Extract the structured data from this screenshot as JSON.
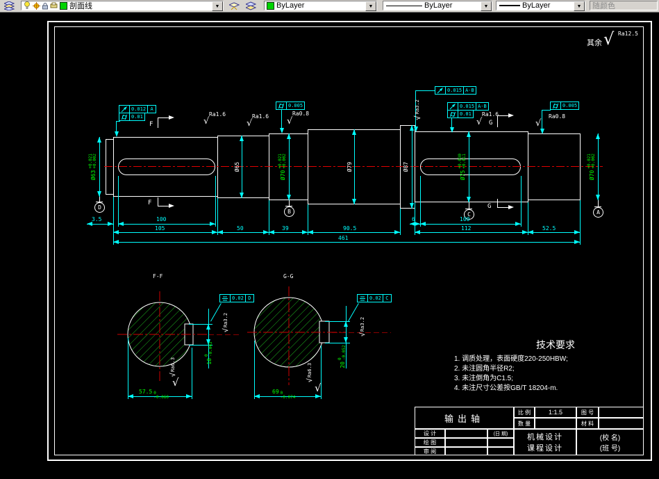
{
  "toolbar": {
    "layer_name": "剖面线",
    "color": "ByLayer",
    "linetype": "ByLayer",
    "lineweight": "ByLayer",
    "plot_style": "随颜色"
  },
  "sheet": {
    "rest_label": "其余",
    "rest_ra": "Ra12.5",
    "ra": {
      "a16": "Ra1.6",
      "a08": "Ra0.8",
      "a32": "Ra3.2",
      "a63": "Ra6.3"
    },
    "markers": {
      "f": "F",
      "g": "G"
    },
    "datums": {
      "left": "D",
      "mid": "B",
      "hub": "C",
      "right": "A"
    },
    "fcf": {
      "left": {
        "v1": "0.012",
        "d1": "A",
        "v2": "0.01"
      },
      "mid": {
        "v": "0.005"
      },
      "r1": {
        "v": "0.015",
        "d": "A-B"
      },
      "r2": {
        "v1": "0.015",
        "d1": "A-B",
        "v2": "0.01"
      },
      "far": {
        "v": "0.005"
      },
      "ff": {
        "v": "0.02",
        "d": "D"
      },
      "gg": {
        "v": "0.02",
        "d": "C"
      }
    },
    "dia": {
      "d63": {
        "t": "Ø63",
        "up": "+0.021",
        "dn": "+0.002"
      },
      "d65": {
        "t": "Ø65"
      },
      "d70a": {
        "t": "Ø70",
        "up": "+0.021",
        "dn": "+0.002"
      },
      "d79": {
        "t": "Ø79"
      },
      "d87": {
        "t": "Ø87"
      },
      "d75": {
        "t": "Ø75",
        "up": "+0.030",
        "dn": "+0.011"
      },
      "d70b": {
        "t": "Ø70",
        "up": "+0.021",
        "dn": "+0.002"
      }
    },
    "len": {
      "l35": "3.5",
      "l100": "100",
      "l105": "105",
      "l50": "50",
      "l39": "39",
      "l905": "90.5",
      "l6": "6",
      "l100r": "100",
      "l112": "112",
      "l525": "52.5",
      "l461": "461"
    },
    "ff": {
      "title": "F-F",
      "w": "57.5",
      "wu": "0",
      "wd": "-0.060",
      "h": "18",
      "hu": "0",
      "hd": "-0.043"
    },
    "gg": {
      "title": "G-G",
      "w": "69",
      "wu": "0",
      "wd": "-0.074",
      "h": "20",
      "hu": "0",
      "hd": "-0.052"
    },
    "tech": {
      "title": "技术要求",
      "i1": "1. 调质处理，表面硬度220-250HBW;",
      "i2": "2. 未注圆角半径R2;",
      "i3": "3. 未注倒角为C1.5;",
      "i4": "4. 未注尺寸公差按GB/T 18204-m."
    },
    "tb": {
      "part": "输出轴",
      "scale_l": "比 例",
      "scale_v": "1:1.5",
      "qty_l": "数 量",
      "fig_l": "图 号",
      "mat_l": "材 料",
      "design_l": "设 计",
      "draw_l": "绘 图",
      "review_l": "审 阅",
      "date_l": "(日 期)",
      "course1": "机械设计",
      "course2": "课程设计",
      "school": "(校  名)",
      "cls": "(班  号)"
    }
  }
}
